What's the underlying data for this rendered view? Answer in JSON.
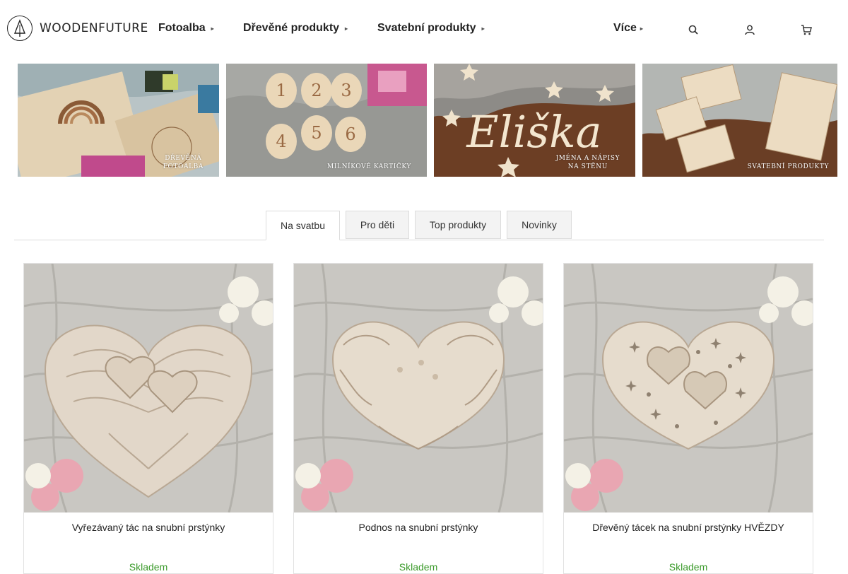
{
  "header": {
    "logo_text": "WOODENFUTURE",
    "nav": [
      {
        "label": "Fotoalba",
        "caret": "▸"
      },
      {
        "label": "Dřevěné produkty",
        "caret": "▸"
      },
      {
        "label": "Svatební produkty",
        "caret": "▸"
      },
      {
        "label": "Více",
        "caret": "▸"
      }
    ],
    "icons": [
      "search-icon",
      "user-icon",
      "cart-icon"
    ]
  },
  "banners": [
    {
      "caption": "DŘEVĚNÁ\nFOTOALBA",
      "name_icon": "photo-album"
    },
    {
      "caption": "MILNÍKOVÉ KARTIČKY",
      "name_icon": "milestone-cards"
    },
    {
      "caption": "JMÉNA A NÁPISY\nNA STĚNU",
      "name_icon": "wall-names"
    },
    {
      "caption": "SVATEBNÍ PRODUKTY",
      "name_icon": "wedding-products"
    }
  ],
  "tabs": [
    {
      "label": "Na svatbu",
      "active": true
    },
    {
      "label": "Pro děti",
      "active": false
    },
    {
      "label": "Top produkty",
      "active": false
    },
    {
      "label": "Novinky",
      "active": false
    }
  ],
  "products": [
    {
      "name": "Vyřezávaný tác na snubní prstýnky",
      "stock": "Skladem"
    },
    {
      "name": "Podnos na snubní prstýnky",
      "stock": "Skladem"
    },
    {
      "name": "Dřevěný tácek na snubní prstýnky HVĚZDY",
      "stock": "Skladem"
    }
  ],
  "colors": {
    "accent_stock": "#3a9a2a",
    "tab_border": "#dcdcdc",
    "wood": "#d9c6aa"
  }
}
